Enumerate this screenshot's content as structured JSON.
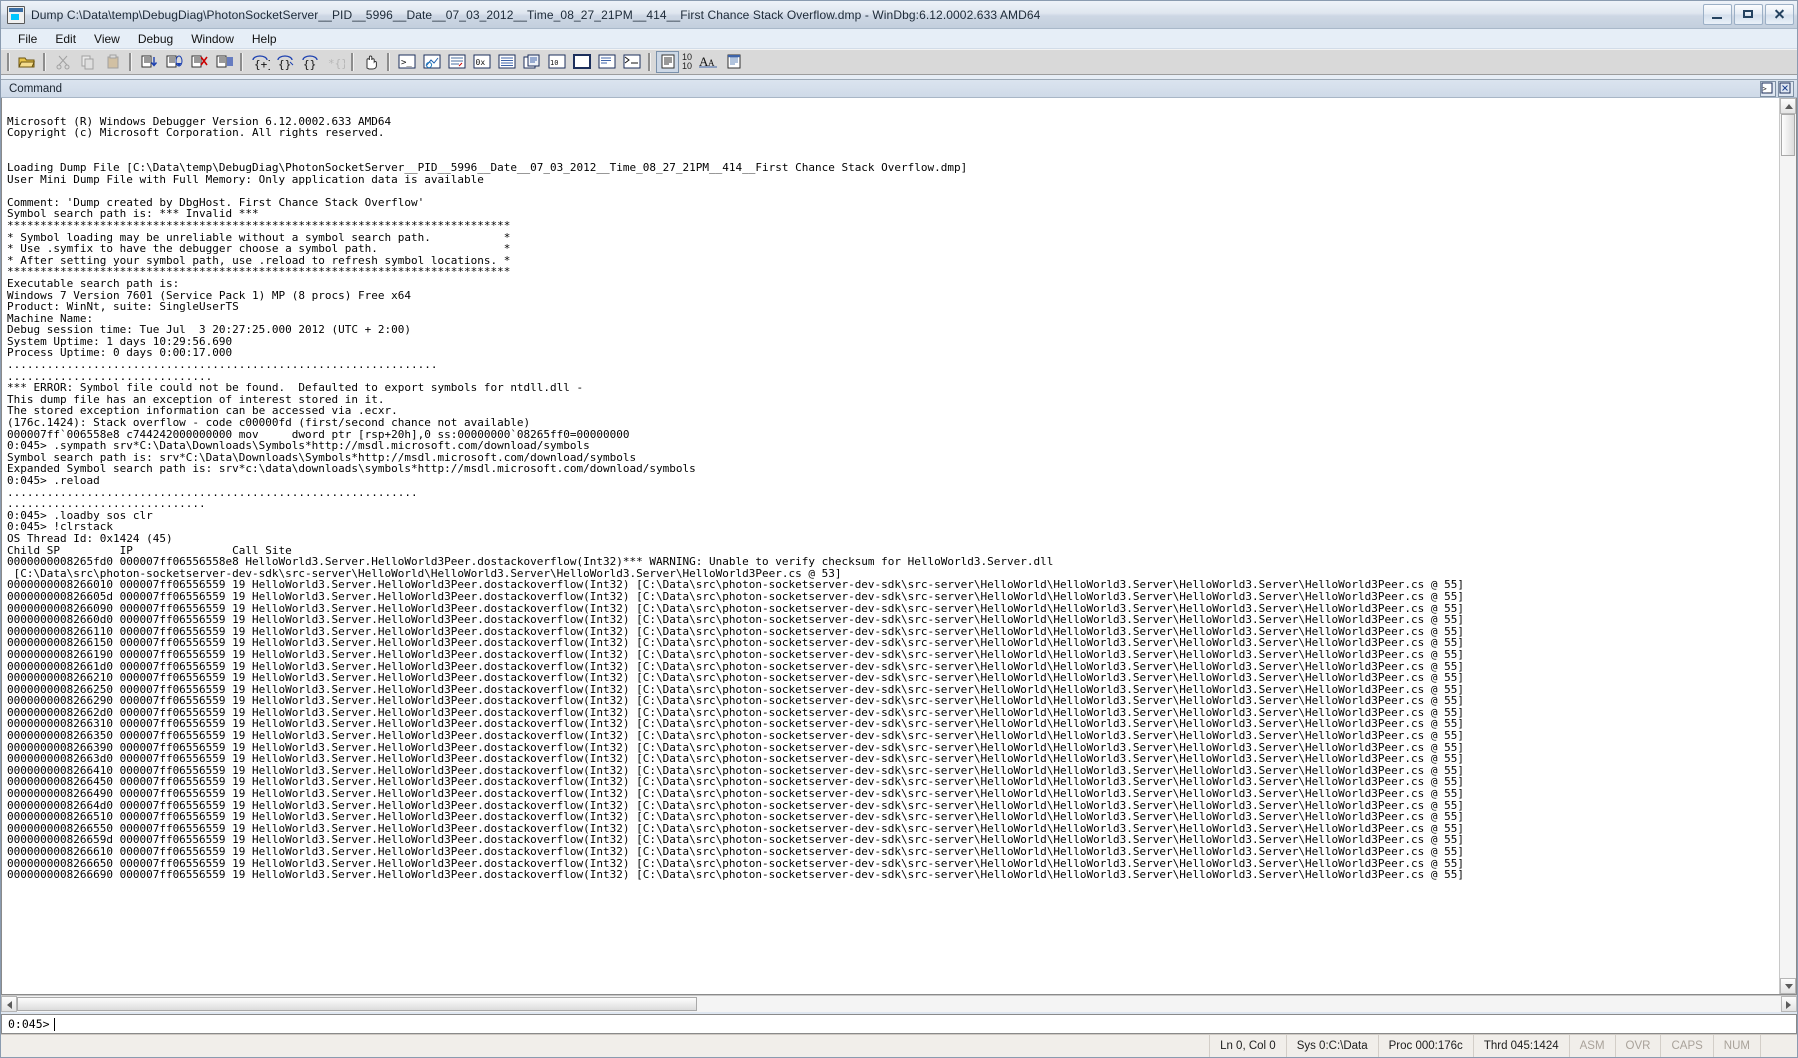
{
  "window": {
    "title": "Dump C:\\Data\\temp\\DebugDiag\\PhotonSocketServer__PID__5996__Date__07_03_2012__Time_08_27_21PM__414__First Chance Stack Overflow.dmp - WinDbg:6.12.0002.633 AMD64",
    "icon": "windbg-icon",
    "minimize_label": "Minimize",
    "maximize_label": "Maximize",
    "close_label": "Close"
  },
  "menu": {
    "items": [
      {
        "label": "File"
      },
      {
        "label": "Edit"
      },
      {
        "label": "View"
      },
      {
        "label": "Debug"
      },
      {
        "label": "Window"
      },
      {
        "label": "Help"
      }
    ]
  },
  "toolbar": {
    "buttons": [
      {
        "name": "open-dump-icon",
        "title": "Open source file",
        "enabled": true
      },
      {
        "name": "cut-icon",
        "title": "Cut",
        "enabled": false
      },
      {
        "name": "copy-icon",
        "title": "Copy",
        "enabled": false
      },
      {
        "name": "paste-icon",
        "title": "Paste",
        "enabled": false
      },
      {
        "name": "step-into-icon",
        "title": "Step Into",
        "enabled": true
      },
      {
        "name": "step-over-icon",
        "title": "Step Over",
        "enabled": true
      },
      {
        "name": "step-out-icon",
        "title": "Step Out",
        "enabled": true
      },
      {
        "name": "run-to-cursor-icon",
        "title": "Run to Cursor",
        "enabled": true
      },
      {
        "name": "break-icon",
        "title": "Break",
        "enabled": true
      },
      {
        "name": "go-icon",
        "title": "Go",
        "enabled": true
      },
      {
        "name": "restart-icon",
        "title": "Restart",
        "enabled": true
      },
      {
        "name": "stop-debugging-icon",
        "title": "Stop Debugging",
        "enabled": false
      },
      {
        "name": "hand-break-icon",
        "title": "Break",
        "enabled": true
      },
      {
        "name": "command-window-icon",
        "title": "Command Window",
        "enabled": true
      },
      {
        "name": "watch-window-icon",
        "title": "Watch Window",
        "enabled": true
      },
      {
        "name": "locals-window-icon",
        "title": "Locals Window",
        "enabled": true
      },
      {
        "name": "registers-window-icon",
        "title": "Registers Window",
        "enabled": true
      },
      {
        "name": "memory-window-icon",
        "title": "Memory Window",
        "enabled": true
      },
      {
        "name": "calls-window-icon",
        "title": "Calls Window",
        "enabled": true
      },
      {
        "name": "disassembly-window-icon",
        "title": "Disassembly Window",
        "enabled": true
      },
      {
        "name": "scratch-pad-icon",
        "title": "Scratch Pad",
        "enabled": true
      },
      {
        "name": "processes-threads-icon",
        "title": "Processes and Threads",
        "enabled": true
      },
      {
        "name": "command-browser-icon",
        "title": "Command Browser",
        "enabled": true
      },
      {
        "name": "source-mode-icon",
        "title": "Source Mode",
        "enabled": true
      }
    ],
    "line_numbers_label": "10\n10",
    "font-size-label": "Aᴀ",
    "notepad_icon": "notepad-icon"
  },
  "command_pane": {
    "caption": "Command",
    "restore_icon": "restore-window-icon",
    "close_icon": "close-window-icon"
  },
  "console": {
    "lines": [
      "",
      "Microsoft (R) Windows Debugger Version 6.12.0002.633 AMD64",
      "Copyright (c) Microsoft Corporation. All rights reserved.",
      "",
      "",
      "Loading Dump File [C:\\Data\\temp\\DebugDiag\\PhotonSocketServer__PID__5996__Date__07_03_2012__Time_08_27_21PM__414__First Chance Stack Overflow.dmp]",
      "User Mini Dump File with Full Memory: Only application data is available",
      "",
      "Comment: 'Dump created by DbgHost. First Chance Stack Overflow'",
      "Symbol search path is: *** Invalid ***",
      "****************************************************************************",
      "* Symbol loading may be unreliable without a symbol search path.           *",
      "* Use .symfix to have the debugger choose a symbol path.                   *",
      "* After setting your symbol path, use .reload to refresh symbol locations. *",
      "****************************************************************************",
      "Executable search path is:",
      "Windows 7 Version 7601 (Service Pack 1) MP (8 procs) Free x64",
      "Product: WinNt, suite: SingleUserTS",
      "Machine Name:",
      "Debug session time: Tue Jul  3 20:27:25.000 2012 (UTC + 2:00)",
      "System Uptime: 1 days 10:29:56.690",
      "Process Uptime: 0 days 0:00:17.000",
      ".................................................................",
      "...............................",
      "*** ERROR: Symbol file could not be found.  Defaulted to export symbols for ntdll.dll -",
      "This dump file has an exception of interest stored in it.",
      "The stored exception information can be accessed via .ecxr.",
      "(176c.1424): Stack overflow - code c00000fd (first/second chance not available)",
      "000007ff`006558e8 c744242000000000 mov     dword ptr [rsp+20h],0 ss:00000000`08265ff0=00000000",
      "0:045> .sympath srv*C:\\Data\\Downloads\\Symbols*http://msdl.microsoft.com/download/symbols",
      "Symbol search path is: srv*C:\\Data\\Downloads\\Symbols*http://msdl.microsoft.com/download/symbols",
      "Expanded Symbol search path is: srv*c:\\data\\downloads\\symbols*http://msdl.microsoft.com/download/symbols",
      "0:045> .reload",
      "..............................................................",
      "..............................",
      "0:045> .loadby sos clr",
      "0:045> !clrstack",
      "OS Thread Id: 0x1424 (45)",
      "Child SP         IP               Call Site",
      "0000000008265fd0 000007ff06556558e8 HelloWorld3.Server.HelloWorld3Peer.dostackoverflow(Int32)*** WARNING: Unable to verify checksum for HelloWorld3.Server.dll",
      " [C:\\Data\\src\\photon-socketserver-dev-sdk\\src-server\\HelloWorld\\HelloWorld3.Server\\HelloWorld3.Server\\HelloWorld3Peer.cs @ 53]"
    ],
    "stack_frame_template": {
      "ip": "000007ff06556559 19",
      "method": "HelloWorld3.Server.HelloWorld3Peer.dostackoverflow(Int32)",
      "source": "[C:\\Data\\src\\photon-socketserver-dev-sdk\\src-server\\HelloWorld\\HelloWorld3.Server\\HelloWorld3.Server\\HelloWorld3Peer.cs @ 55]"
    },
    "stack_frames": [
      "0000000008266010 000007ff06556559 19",
      "000000000826605d 000007ff06556559 19",
      "0000000008266090 000007ff06556559 19",
      "00000000082660d0 000007ff06556559 19",
      "0000000008266110 000007ff06556559 19",
      "0000000008266150 000007ff06556559 19",
      "0000000008266190 000007ff06556559 19",
      "00000000082661d0 000007ff06556559 19",
      "0000000008266210 000007ff06556559 19",
      "0000000008266250 000007ff06556559 19",
      "0000000008266290 000007ff06556559 19",
      "00000000082662d0 000007ff06556559 19",
      "0000000008266310 000007ff06556559 19",
      "0000000008266350 000007ff06556559 19",
      "0000000008266390 000007ff06556559 19",
      "00000000082663d0 000007ff06556559 19",
      "0000000008266410 000007ff06556559 19",
      "0000000008266450 000007ff06556559 19",
      "0000000008266490 000007ff06556559 19",
      "00000000082664d0 000007ff06556559 19",
      "0000000008266510 000007ff06556559 19",
      "0000000008266550 000007ff06556559 19",
      "000000000826659d 000007ff06556559 19",
      "0000000008266610 000007ff06556559 19",
      "0000000008266650 000007ff06556559 19",
      "0000000008266690 000007ff06556559 19"
    ]
  },
  "prompt": {
    "label": "0:045>",
    "value": "",
    "placeholder": ""
  },
  "statusbar": {
    "cells": [
      {
        "label": "Ln 0, Col 0",
        "dim": false
      },
      {
        "label": "Sys 0:C:\\Data",
        "dim": false
      },
      {
        "label": "Proc 000:176c",
        "dim": false
      },
      {
        "label": "Thrd 045:1424",
        "dim": false
      },
      {
        "label": "ASM",
        "dim": true
      },
      {
        "label": "OVR",
        "dim": true
      },
      {
        "label": "CAPS",
        "dim": true
      },
      {
        "label": "NUM",
        "dim": true
      }
    ]
  }
}
